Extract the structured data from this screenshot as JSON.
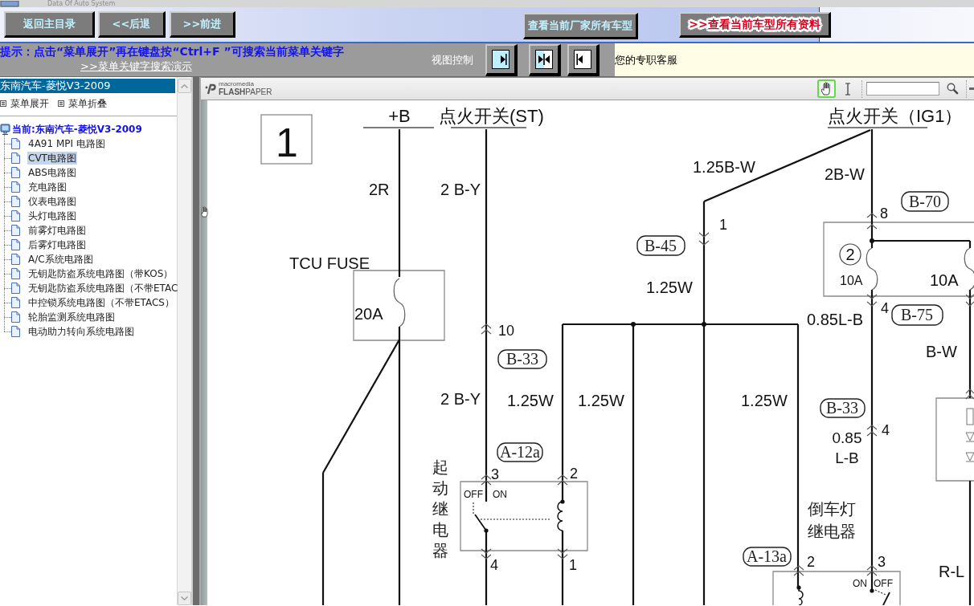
{
  "header": {
    "title": "Data Of Auto System",
    "nav_buttons": [
      {
        "label": "返回主目录"
      },
      {
        "label": "<<后退"
      },
      {
        "label": ">>前进"
      }
    ],
    "vendor_buttons": [
      {
        "label": "查看当前厂家所有车型",
        "kind": "normal"
      },
      {
        "label": ">>查看当前车型所有资料",
        "kind": "highlight"
      }
    ]
  },
  "hint_bar": {
    "hint": "提示：点击“菜单展开”再在键盘按“Ctrl+F ”可搜索当前菜单关键字",
    "link": ">>菜单关键字搜索演示",
    "view_control": {
      "label": "视图控制",
      "buttons": [
        {
          "kind": "expand"
        },
        {
          "kind": "split"
        },
        {
          "kind": "collapse"
        }
      ]
    },
    "support": "您的专职客服"
  },
  "sidebar": {
    "title": "东南汽车-菱悦V3-2009",
    "actions": [
      {
        "label": "菜单展开"
      },
      {
        "label": "菜单折叠"
      }
    ],
    "tree": {
      "label": "当前:东南汽车-菱悦V3-2009",
      "children": [
        {
          "label": "4A91 MPI 电路图",
          "selected": false
        },
        {
          "label": "CVT电路图",
          "selected": true
        },
        {
          "label": "ABS电路图",
          "selected": false
        },
        {
          "label": "充电路图",
          "selected": false
        },
        {
          "label": "仪表电路图",
          "selected": false
        },
        {
          "label": "头灯电路图",
          "selected": false
        },
        {
          "label": "前雾灯电路图",
          "selected": false
        },
        {
          "label": "后雾灯电路图",
          "selected": false
        },
        {
          "label": "A/C系统电路图",
          "selected": false
        },
        {
          "label": "无钥匙防盗系统电路图（带KOS）",
          "selected": false
        },
        {
          "label": "无钥匙防盗系统电路图（不带ETAC",
          "selected": false
        },
        {
          "label": "中控锁系统电路图（不带ETACS）",
          "selected": false
        },
        {
          "label": "轮胎监测系统电路图",
          "selected": false
        },
        {
          "label": "电动助力转向系统电路图",
          "selected": false
        }
      ]
    }
  },
  "viewer": {
    "logo": {
      "brand": "macromedia",
      "product": "**FLASH**PAPER"
    },
    "tools": [
      {
        "kind": "hand",
        "selected": true
      },
      {
        "kind": "text_select",
        "selected": false
      }
    ],
    "diagram": {
      "labels": [
        {
          "kind": "page_number",
          "text": "1"
        },
        {
          "kind": "source",
          "text": "+B"
        },
        {
          "kind": "source",
          "text": "点火开关(ST)"
        },
        {
          "kind": "source",
          "text": "点火开关（IG1）"
        },
        {
          "kind": "wire",
          "text": "1.25B-W"
        },
        {
          "kind": "wire",
          "text": "2B-W"
        },
        {
          "kind": "wire",
          "text": "2R"
        },
        {
          "kind": "wire",
          "text": "2 B-Y"
        },
        {
          "kind": "connector",
          "text": "B-70"
        },
        {
          "kind": "pin",
          "text": "8"
        },
        {
          "kind": "pin",
          "text": "1"
        },
        {
          "kind": "connector",
          "text": "B-45"
        },
        {
          "kind": "circled",
          "text": "2"
        },
        {
          "kind": "fuse_name",
          "text": "TCU FUSE"
        },
        {
          "kind": "rating",
          "text": "10A"
        },
        {
          "kind": "rating",
          "text": "10A"
        },
        {
          "kind": "wire",
          "text": "1.25W"
        },
        {
          "kind": "rating",
          "text": "20A"
        },
        {
          "kind": "pin",
          "text": "4"
        },
        {
          "kind": "connector",
          "text": "B-75"
        },
        {
          "kind": "wire",
          "text": "0.85L-B"
        },
        {
          "kind": "pin",
          "text": "10"
        },
        {
          "kind": "wire",
          "text": "B-W"
        },
        {
          "kind": "connector",
          "text": "B-33"
        },
        {
          "kind": "wire",
          "text": "2 B-Y"
        },
        {
          "kind": "wire",
          "text": "1.25W"
        },
        {
          "kind": "wire",
          "text": "1.25W"
        },
        {
          "kind": "wire",
          "text": "1.25W"
        },
        {
          "kind": "connector",
          "text": "B-33"
        },
        {
          "kind": "pin",
          "text": "4"
        },
        {
          "kind": "wire",
          "lines": [
            "0.85",
            "L-B"
          ]
        },
        {
          "kind": "connector",
          "text": "A-12a"
        },
        {
          "kind": "pin",
          "text": "3"
        },
        {
          "kind": "pin",
          "text": "2"
        },
        {
          "kind": "relay_vertical",
          "text": "起动继电器"
        },
        {
          "kind": "switch",
          "text": "OFF"
        },
        {
          "kind": "switch",
          "text": "ON"
        },
        {
          "kind": "relay",
          "lines": [
            "倒车灯",
            "继电器"
          ]
        },
        {
          "kind": "pin",
          "text": "4"
        },
        {
          "kind": "pin",
          "text": "1"
        },
        {
          "kind": "connector",
          "text": "A-13a"
        },
        {
          "kind": "pin",
          "text": "2"
        },
        {
          "kind": "pin",
          "text": "3"
        },
        {
          "kind": "switch",
          "text": "ON"
        },
        {
          "kind": "switch",
          "text": "OFF"
        },
        {
          "kind": "wire",
          "text": "R-L"
        }
      ]
    }
  }
}
